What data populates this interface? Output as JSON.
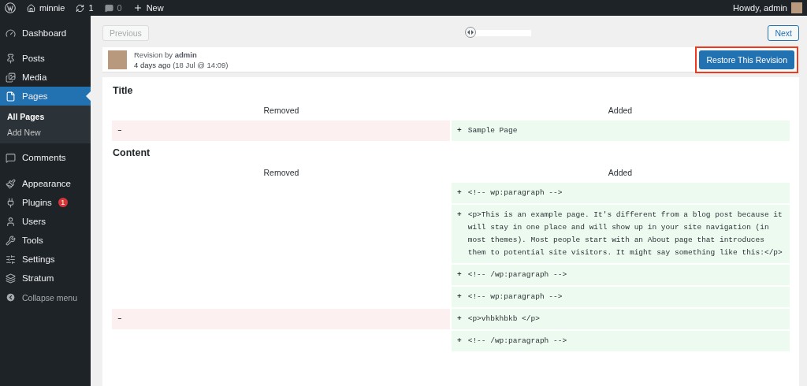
{
  "admin_bar": {
    "site": "minnie",
    "updates": "1",
    "comments": "0",
    "new": "New",
    "greeting": "Howdy, admin"
  },
  "sidebar": {
    "items": [
      {
        "label": "Dashboard",
        "selected": false
      },
      {
        "label": "Posts",
        "selected": false
      },
      {
        "label": "Media",
        "selected": false
      },
      {
        "label": "Pages",
        "selected": true,
        "children": [
          {
            "label": "All Pages",
            "selected": true
          },
          {
            "label": "Add New",
            "selected": false
          }
        ]
      },
      {
        "label": "Comments",
        "selected": false
      },
      {
        "label": "Appearance",
        "selected": false
      },
      {
        "label": "Plugins",
        "selected": false,
        "badge": "1"
      },
      {
        "label": "Users",
        "selected": false
      },
      {
        "label": "Tools",
        "selected": false
      },
      {
        "label": "Settings",
        "selected": false
      },
      {
        "label": "Stratum",
        "selected": false
      }
    ],
    "collapse": "Collapse menu"
  },
  "navigation": {
    "previous": {
      "label": "Previous",
      "disabled": true
    },
    "next": {
      "label": "Next",
      "disabled": false
    },
    "slider": {
      "level": 0
    }
  },
  "revision": {
    "byline": "Revision by **admin**",
    "time": "4 days ago",
    "date": "(18 Jul @ 14:09)",
    "restore_button": "Restore This Revision",
    "highlighted": true
  },
  "sections": [
    {
      "heading": "Title",
      "removed_header": "Removed",
      "added_header": "Added",
      "rows": [
        {
          "removed": "–",
          "added": "+",
          "added_text": "Sample Page"
        }
      ]
    },
    {
      "heading": "Content",
      "removed_header": "Removed",
      "added_header": "Added",
      "rows": [
        {
          "added": "+",
          "added_text": "<!-- wp:paragraph -->"
        },
        {
          "added": "+",
          "added_text": "<p>This is an example page. It's different from a blog post because it will stay in one place and will show up in your site navigation (in most themes). Most people start with an About page that introduces them to potential site visitors. It might say something like this:</p>"
        },
        {
          "added": "+",
          "added_text": "<!-- /wp:paragraph -->"
        },
        {
          "added": "+",
          "added_text": "<!-- wp:paragraph -->"
        },
        {
          "removed": "–",
          "added": "+",
          "added_text": "<p>vhbkhbkb </p>"
        },
        {
          "added": "+",
          "added_text": "<!-- /wp:paragraph -->"
        }
      ]
    }
  ]
}
